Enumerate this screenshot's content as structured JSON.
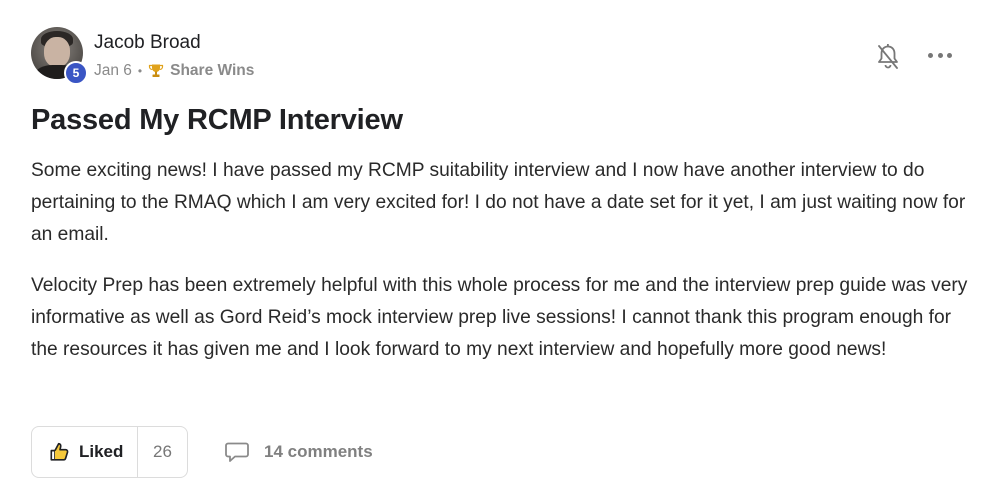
{
  "author": {
    "name": "Jacob Broad",
    "level": "5"
  },
  "meta": {
    "date": "Jan 6",
    "separator": "•",
    "category_icon": "trophy-icon",
    "category": "Share Wins"
  },
  "header_actions": {
    "notifications_icon": "bell-muted-icon",
    "more_icon": "more-horizontal-icon"
  },
  "post": {
    "title": "Passed My RCMP Interview",
    "paragraphs": [
      "Some exciting news! I have passed my RCMP suitability interview and I now have another interview to do pertaining to the RMAQ which I am very excited for! I do not have a date set for it yet, I am just waiting now for an email.",
      "Velocity Prep has been extremely helpful with this whole process for me and the interview prep guide was very informative as well as Gord Reid’s mock interview prep live sessions! I cannot thank this program enough for the resources it has given me and I look forward to my next interview and hopefully more good news!"
    ]
  },
  "footer": {
    "like_label": "Liked",
    "like_count": "26",
    "comments_label": "14 comments",
    "like_icon": "thumbs-up-icon",
    "comments_icon": "comment-icon"
  },
  "colors": {
    "level_badge": "#3a55c4",
    "text": "#202124",
    "muted": "#8a8a8a",
    "trophy": "#e0a21b"
  }
}
